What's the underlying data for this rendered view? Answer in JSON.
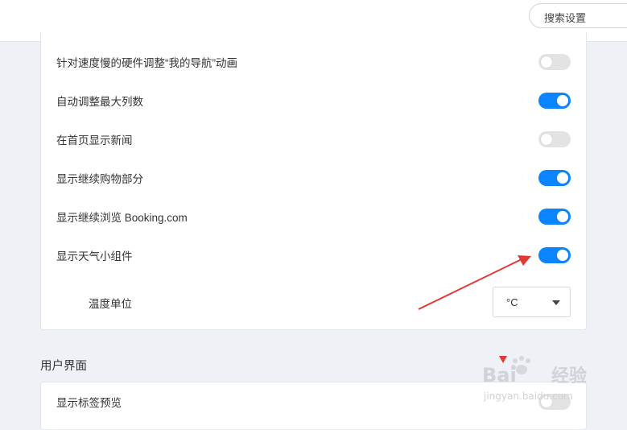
{
  "search": {
    "placeholder": "搜索设置"
  },
  "settings": [
    {
      "label": "针对速度慢的硬件调整“我的导航”动画",
      "enabled": false
    },
    {
      "label": "自动调整最大列数",
      "enabled": true
    },
    {
      "label": "在首页显示新闻",
      "enabled": false
    },
    {
      "label": "显示继续购物部分",
      "enabled": true
    },
    {
      "label": "显示继续浏览 Booking.com",
      "enabled": true
    },
    {
      "label": "显示天气小组件",
      "enabled": true
    }
  ],
  "temperature_unit": {
    "label": "温度单位",
    "value": "°C"
  },
  "ui_section": {
    "title": "用户界面",
    "settings": [
      {
        "label": "显示标签预览",
        "enabled": false
      }
    ]
  },
  "colors": {
    "accent": "#0a84ff",
    "toggle_off": "#e3e3e3",
    "annotation_arrow": "#e53935"
  },
  "watermark": {
    "text": "Baidu经验",
    "url": "jingyan.baidu.com"
  }
}
